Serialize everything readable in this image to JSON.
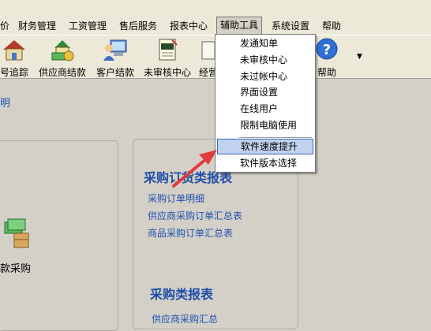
{
  "menubar": {
    "items": [
      {
        "label": "价"
      },
      {
        "label": "财务管理"
      },
      {
        "label": "工资管理"
      },
      {
        "label": "售后服务"
      },
      {
        "label": "报表中心"
      },
      {
        "label": "辅助工具"
      },
      {
        "label": "系统设置"
      },
      {
        "label": "帮助"
      }
    ]
  },
  "toolbar": {
    "items": [
      {
        "label": "号追踪",
        "icon": "house-icon"
      },
      {
        "label": "供应商结款",
        "icon": "money-house-icon"
      },
      {
        "label": "客户结款",
        "icon": "computer-user-icon"
      },
      {
        "label": "未审核中心",
        "icon": "notepad-icon"
      },
      {
        "label": "经营",
        "icon": "document-icon"
      },
      {
        "label": "帮助",
        "icon": "help-icon"
      }
    ]
  },
  "dropdown": {
    "items": [
      {
        "label": "发通知单"
      },
      {
        "label": "未审核中心"
      },
      {
        "label": "未过帐中心"
      },
      {
        "label": "界面设置"
      },
      {
        "label": "在线用户"
      },
      {
        "label": "限制电脑使用"
      },
      {
        "label": "软件速度提升"
      },
      {
        "label": "软件版本选择"
      }
    ]
  },
  "content": {
    "top_link": "明",
    "left_panel_label": "款采购",
    "purchase_order_reports": {
      "title": "采购订货类报表",
      "links": [
        "采购订单明细",
        "供应商采购订单汇总表",
        "商品采购订单汇总表"
      ]
    },
    "purchase_reports": {
      "title": "采购类报表",
      "links": [
        "供应商采购汇总"
      ]
    }
  },
  "colors": {
    "link": "#2050b0",
    "panel_title": "#1f4fa8",
    "highlight": "#c1d2ee",
    "arrow": "#e23b3b"
  }
}
